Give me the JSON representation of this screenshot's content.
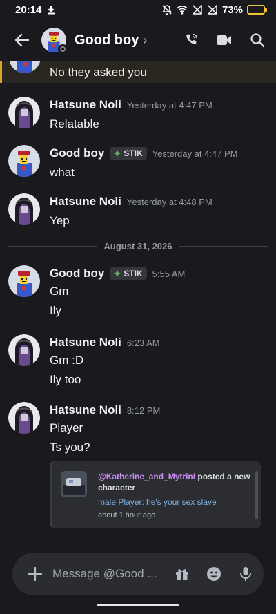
{
  "status_bar": {
    "time": "20:14",
    "battery": "73%",
    "battery_level": 0.73
  },
  "header": {
    "title": "Good boy",
    "chevron": "›"
  },
  "partial_message": {
    "text": "No they asked you"
  },
  "messages": [
    {
      "author": "Hatsune Noli",
      "timestamp": "Yesterday at 4:47 PM",
      "lines": [
        "Relatable"
      ]
    },
    {
      "author": "Good boy",
      "tag": "STIK",
      "timestamp": "Yesterday at 4:47 PM",
      "lines": [
        "what"
      ]
    },
    {
      "author": "Hatsune Noli",
      "timestamp": "Yesterday at 4:48 PM",
      "lines": [
        "Yep"
      ]
    },
    {
      "author": "Good boy",
      "tag": "STIK",
      "timestamp": "5:55 AM",
      "lines": [
        "Gm",
        "Ily"
      ]
    },
    {
      "author": "Hatsune Noli",
      "timestamp": "6:23 AM",
      "lines": [
        "Gm :D",
        "Ily too"
      ]
    },
    {
      "author": "Hatsune Noli",
      "timestamp": "8:12 PM",
      "lines": [
        "Player",
        "Ts you?"
      ]
    }
  ],
  "date_divider": "August 31, 2026",
  "embed": {
    "mention": "@Katherine_and_MytrinI",
    "title_rest": " posted a new character",
    "description": "male Player: he's your sex slave",
    "time": "about 1 hour ago"
  },
  "composer": {
    "placeholder": "Message @Good ..."
  },
  "colors": {
    "background": "#1a1a1e",
    "accent_mention": "#c98df0",
    "link_blue": "#7fb0e0",
    "battery": "#f1c232",
    "highlight_bar": "#d4a72c"
  }
}
